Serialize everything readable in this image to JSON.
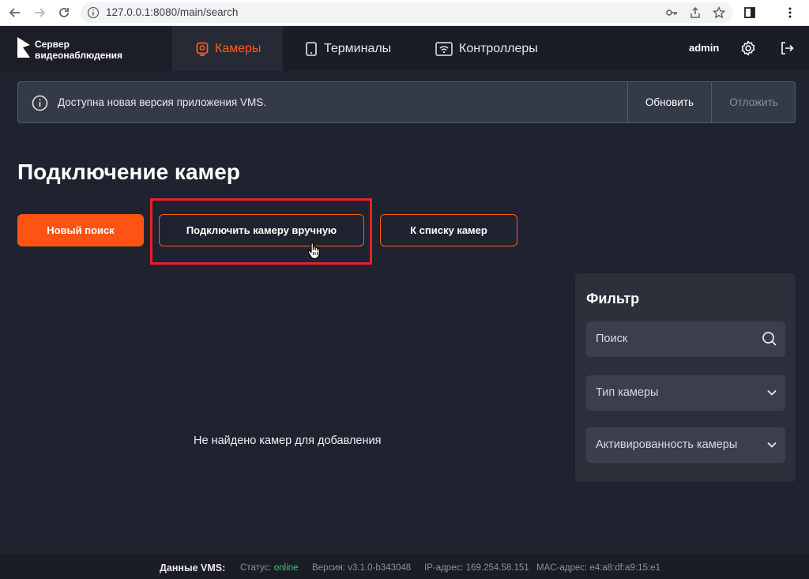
{
  "browser": {
    "url": "127.0.0.1:8080/main/search"
  },
  "header": {
    "logo_line1": "Сервер",
    "logo_line2": "видеонаблюдения",
    "tabs": [
      {
        "label": "Камеры",
        "active": true
      },
      {
        "label": "Терминалы",
        "active": false
      },
      {
        "label": "Контроллеры",
        "active": false
      }
    ],
    "user": "admin",
    "accent_color": "#ff5c14"
  },
  "banner": {
    "message": "Доступна новая версия приложения VMS.",
    "update_label": "Обновить",
    "postpone_label": "Отложить"
  },
  "main": {
    "title": "Подключение камер",
    "new_search_label": "Новый поиск",
    "connect_manual_label": "Подключить камеру вручную",
    "camera_list_label": "К списку камер",
    "empty_message": "Не найдено камер для добавления"
  },
  "filter": {
    "title": "Фильтр",
    "search_placeholder": "Поиск",
    "camera_type_label": "Тип камеры",
    "activation_label": "Активированность камеры"
  },
  "footer": {
    "label": "Данные VMS:",
    "status_label": "Статус:",
    "status_value": "online",
    "version": "Версия: v3.1.0-b343048",
    "ip": "IP-адрес: 169.254.58.151",
    "mac": "MAC-адрес: e4:a8:df:a9:15:e1"
  }
}
